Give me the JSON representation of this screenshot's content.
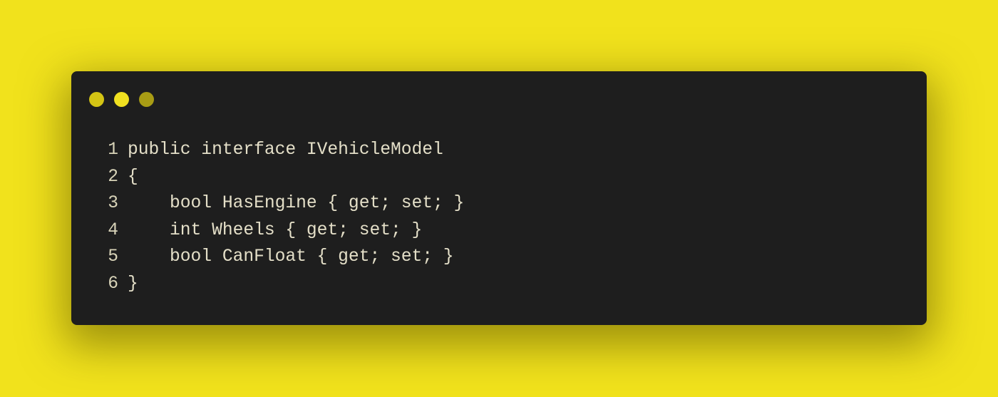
{
  "window": {
    "dots": [
      {
        "name": "close",
        "color": "#d4c414"
      },
      {
        "name": "minimize",
        "color": "#f0e020"
      },
      {
        "name": "maximize",
        "color": "#a89c14"
      }
    ]
  },
  "code": {
    "lines": [
      {
        "number": "1",
        "text": "public interface IVehicleModel"
      },
      {
        "number": "2",
        "text": "{"
      },
      {
        "number": "3",
        "text": "    bool HasEngine { get; set; }"
      },
      {
        "number": "4",
        "text": "    int Wheels { get; set; }"
      },
      {
        "number": "5",
        "text": "    bool CanFloat { get; set; }"
      },
      {
        "number": "6",
        "text": "}"
      }
    ]
  }
}
